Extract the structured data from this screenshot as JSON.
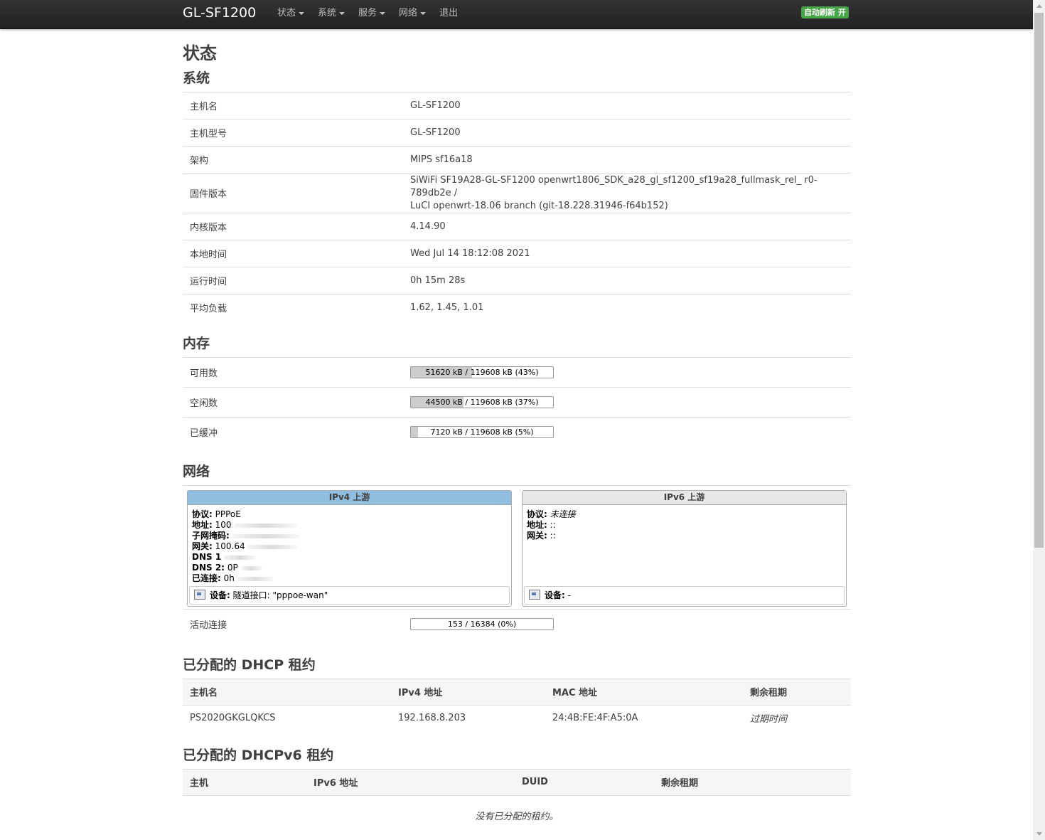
{
  "nav": {
    "brand": "GL-SF1200",
    "menu": [
      "状态",
      "系统",
      "服务",
      "网络"
    ],
    "logout": "退出",
    "refresh_badge": "自动刷新 开"
  },
  "page_title": "状态",
  "system": {
    "heading": "系统",
    "rows": [
      {
        "label": "主机名",
        "value": "GL-SF1200"
      },
      {
        "label": "主机型号",
        "value": "GL-SF1200"
      },
      {
        "label": "架构",
        "value": "MIPS sf16a18"
      },
      {
        "label": "固件版本",
        "value": "SiWiFi SF19A28-GL-SF1200 openwrt1806_SDK_a28_gl_sf1200_sf19a28_fullmask_rel_ r0-789db2e /",
        "value2": "LuCI openwrt-18.06 branch (git-18.228.31946-f64b152)"
      },
      {
        "label": "内核版本",
        "value": "4.14.90"
      },
      {
        "label": "本地时间",
        "value": "Wed Jul 14 18:12:08 2021"
      },
      {
        "label": "运行时间",
        "value": "0h 15m 28s"
      },
      {
        "label": "平均负载",
        "value": "1.62, 1.45, 1.01"
      }
    ]
  },
  "memory": {
    "heading": "内存",
    "rows": [
      {
        "label": "可用数",
        "text": "51620 kB / 119608 kB (43%)",
        "percent": 43
      },
      {
        "label": "空闲数",
        "text": "44500 kB / 119608 kB (37%)",
        "percent": 37
      },
      {
        "label": "已缓冲",
        "text": "7120 kB / 119608 kB (5%)",
        "percent": 5
      }
    ]
  },
  "network": {
    "heading": "网络",
    "ipv4": {
      "title": "IPv4 上游",
      "protocol_label": "协议:",
      "protocol": "PPPoE",
      "address_label": "地址:",
      "address": "100",
      "netmask_label": "子网掩码:",
      "gateway_label": "网关:",
      "gateway": "100.64",
      "dns1_label": "DNS 1",
      "dns2_label": "DNS 2:",
      "dns2": "0P",
      "connected_label": "已连接:",
      "connected": "0h",
      "device_label": "设备:",
      "device": "隧道接口: \"pppoe-wan\""
    },
    "ipv6": {
      "title": "IPv6 上游",
      "protocol_label": "协议:",
      "protocol": "未连接",
      "address_label": "地址:",
      "address": "::",
      "gateway_label": "网关:",
      "gateway": "::",
      "device_label": "设备:",
      "device": "-"
    },
    "active_connections": {
      "label": "活动连接",
      "text": "153 / 16384 (0%)",
      "percent": 0
    }
  },
  "dhcp": {
    "heading": "已分配的 DHCP 租约",
    "columns": [
      "主机名",
      "IPv4 地址",
      "MAC 地址",
      "剩余租期"
    ],
    "rows": [
      {
        "host": "PS2020GKGLQKCS",
        "ip": "192.168.8.203",
        "mac": "24:4B:FE:4F:A5:0A",
        "lease": "过期时间"
      }
    ]
  },
  "dhcpv6": {
    "heading": "已分配的 DHCPv6 租约",
    "columns": [
      "主机",
      "IPv6 地址",
      "DUID",
      "剩余租期"
    ],
    "empty": "没有已分配的租约。"
  }
}
